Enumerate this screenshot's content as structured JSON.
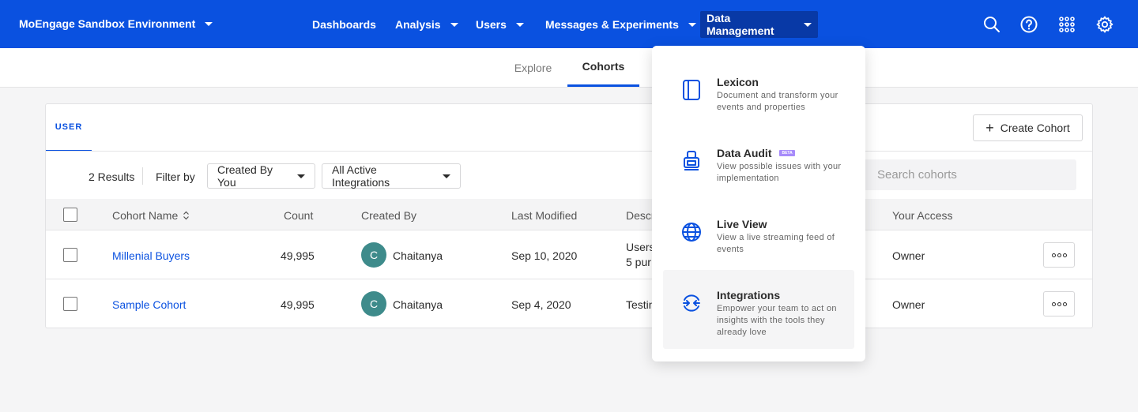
{
  "header": {
    "environment": "MoEngage Sandbox Environment",
    "nav": [
      "Dashboards",
      "Analysis",
      "Users",
      "Messages & Experiments",
      "Data Management"
    ],
    "icons": [
      "search-icon",
      "help-icon",
      "apps-grid-icon",
      "settings-icon"
    ],
    "brand_color": "#0a51e0"
  },
  "subnav": {
    "tabs": [
      "Explore",
      "Cohorts"
    ],
    "active": "Cohorts"
  },
  "card": {
    "tab": "USER",
    "create_button": "Create Cohort",
    "results": "2 Results",
    "filter_label": "Filter by",
    "filter_created": "Created By You",
    "filter_integrations": "All Active Integrations",
    "search_placeholder": "Search cohorts",
    "columns": {
      "name": "Cohort Name",
      "count": "Count",
      "created_by": "Created By",
      "last_modified": "Last Modified",
      "description": "Descr",
      "access": "Your Access"
    },
    "rows": [
      {
        "name": "Millenial Buyers",
        "count": "49,995",
        "initial": "C",
        "created_by": "Chaitanya",
        "modified": "Sep 10, 2020",
        "desc1": "Users",
        "desc2": "5 pur",
        "access": "Owner"
      },
      {
        "name": "Sample Cohort",
        "count": "49,995",
        "initial": "C",
        "created_by": "Chaitanya",
        "modified": "Sep 4, 2020",
        "desc1": "Testin",
        "desc2": "",
        "access": "Owner"
      }
    ]
  },
  "dropdown": {
    "items": [
      {
        "title": "Lexicon",
        "desc": "Document and transform your events and properties",
        "icon": "book-icon"
      },
      {
        "title": "Data Audit",
        "badge": "BETA",
        "desc": "View possible issues with your implementation",
        "icon": "audit-icon"
      },
      {
        "title": "Live View",
        "desc": "View a live streaming feed of events",
        "icon": "globe-icon"
      },
      {
        "title": "Integrations",
        "desc": "Empower your team to act on insights with the tools they already love",
        "icon": "integrations-icon"
      }
    ]
  }
}
